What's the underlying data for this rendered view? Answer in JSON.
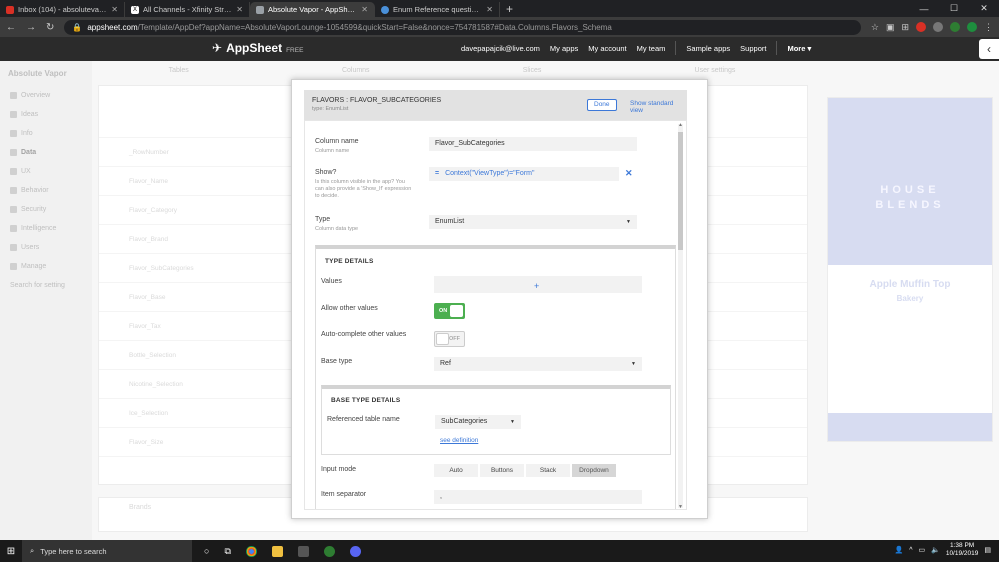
{
  "browser": {
    "tabs": [
      {
        "title": "Inbox (104) - absolutevaporfoco",
        "favicon_color": "#d93025",
        "active": false
      },
      {
        "title": "All Channels - Xfinity Stream",
        "favicon_color": "#ffffff",
        "active": false
      },
      {
        "title": "Absolute Vapor - AppSheet",
        "favicon_color": "#9aa0a6",
        "active": true
      },
      {
        "title": "Enum Reference question - Que",
        "favicon_color": "#4a90d9",
        "active": false
      }
    ],
    "new_tab": "+",
    "url_host": "appsheet.com",
    "url_path": "/Template/AppDef?appName=AbsoluteVaporLounge-1054599&quickStart=False&nonce=754781587#Data.Columns.Flavors_Schema"
  },
  "appsheet": {
    "logo_text": "AppSheet",
    "plan": "FREE",
    "user_email": "davepapajcik@live.com",
    "nav": [
      "My apps",
      "My account",
      "My team"
    ],
    "nav2": [
      "Sample apps",
      "Support"
    ],
    "more": "More ▾"
  },
  "background": {
    "app_name": "Absolute Vapor",
    "left_items": [
      "Overview",
      "Ideas",
      "Info",
      "Data",
      "UX",
      "Behavior",
      "Security",
      "Intelligence",
      "Users",
      "Manage"
    ],
    "search_placeholder": "Search for setting",
    "tabs": [
      "Tables",
      "Columns",
      "Slices",
      "User settings"
    ],
    "rows": [
      "_RowNumber",
      "Flavor_Name",
      "Flavor_Category",
      "Flavor_Brand",
      "Flavor_SubCategories",
      "Flavor_Base",
      "Flavor_Tax",
      "Bottle_Selection",
      "Nicotine_Selection",
      "Ice_Selection",
      "Flavor_Size"
    ],
    "preview_brand_line1": "HOUSE",
    "preview_brand_line2": "BLENDS",
    "preview_title": "Apple Muffin Top",
    "preview_sub": "Bakery",
    "second_table": "Brands"
  },
  "modal": {
    "title": "FLAVORS : FLAVOR_SUBCATEGORIES",
    "subtitle": "type: EnumList",
    "done_label": "Done",
    "std_view_label": "Show standard view",
    "column_name": {
      "label": "Column name",
      "hint": "Column name",
      "value": "Flavor_SubCategories"
    },
    "show": {
      "label": "Show?",
      "hint": "Is this column visible in the app? You can also provide a 'Show_If' expression to decide.",
      "eq_symbol": "=",
      "value": "Context(\"ViewType\")=\"Form\"",
      "clear": "✕"
    },
    "type": {
      "label": "Type",
      "hint": "Column data type",
      "value": "EnumList"
    },
    "type_details": {
      "title": "TYPE DETAILS",
      "values_label": "Values",
      "add_symbol": "+",
      "allow_other_label": "Allow other values",
      "allow_other_state": "ON",
      "autocomplete_label": "Auto-complete other values",
      "autocomplete_state": "OFF",
      "base_type_label": "Base type",
      "base_type_value": "Ref",
      "base_details_title": "BASE TYPE DETAILS",
      "ref_table_label": "Referenced table name",
      "ref_table_value": "SubCategories",
      "see_definition": "see definition",
      "input_mode_label": "Input mode",
      "input_modes": [
        "Auto",
        "Buttons",
        "Stack",
        "Dropdown"
      ],
      "input_mode_selected": "Dropdown",
      "item_separator_label": "Item separator",
      "item_separator_value": ","
    }
  },
  "taskbar": {
    "search_placeholder": "Type here to search",
    "time": "1:38 PM",
    "date": "10/19/2019"
  }
}
